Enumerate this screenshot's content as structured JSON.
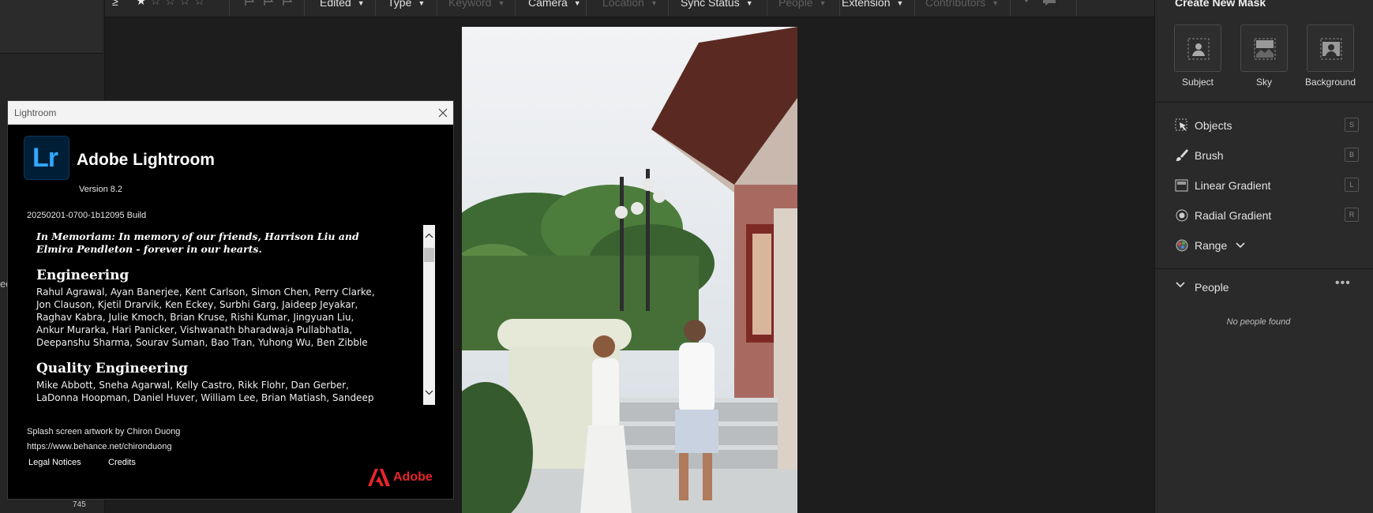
{
  "filter_bar": {
    "items": [
      {
        "label": "Edited",
        "enabled": true
      },
      {
        "label": "Type",
        "enabled": true
      },
      {
        "label": "Keyword",
        "enabled": false
      },
      {
        "label": "Camera",
        "enabled": true
      },
      {
        "label": "Location",
        "enabled": false
      },
      {
        "label": "Sync Status",
        "enabled": true
      },
      {
        "label": "People",
        "enabled": false
      },
      {
        "label": "Extension",
        "enabled": true
      },
      {
        "label": "Contributors",
        "enabled": false
      }
    ],
    "rating_prefix": "≥",
    "stars": 5
  },
  "left_strip": {
    "cut_text": "ed",
    "count": "745"
  },
  "right_panel": {
    "title": "Create New Mask",
    "mask_types": [
      {
        "label": "Subject",
        "icon": "subject-icon"
      },
      {
        "label": "Sky",
        "icon": "sky-icon"
      },
      {
        "label": "Background",
        "icon": "background-icon"
      }
    ],
    "tools": [
      {
        "label": "Objects",
        "key": "S",
        "icon": "objects-icon"
      },
      {
        "label": "Brush",
        "key": "B",
        "icon": "brush-icon"
      },
      {
        "label": "Linear Gradient",
        "key": "L",
        "icon": "linear-gradient-icon"
      },
      {
        "label": "Radial Gradient",
        "key": "R",
        "icon": "radial-gradient-icon"
      },
      {
        "label": "Range",
        "key": "",
        "icon": "range-icon"
      }
    ],
    "people": {
      "label": "People",
      "empty_text": "No people found"
    }
  },
  "about": {
    "window_title": "Lightroom",
    "logo_text": "Lr",
    "app_name": "Adobe Lightroom",
    "version": "Version 8.2",
    "build": "20250201-0700-1b12095 Build",
    "memoriam": "In Memoriam: In memory of our friends, Harrison Liu and Elmira Pendleton - forever in our hearts.",
    "sections": [
      {
        "heading": "Engineering",
        "names": "Rahul Agrawal, Ayan Banerjee, Kent Carlson, Simon Chen, Perry Clarke, Jon Clauson, Kjetil Drarvik, Ken Eckey, Surbhi Garg, Jaideep Jeyakar, Raghav Kabra, Julie Kmoch, Brian Kruse, Rishi Kumar, Jingyuan Liu, Ankur Murarka, Hari Panicker, Vishwanath bharadwaja Pullabhatla, Deepanshu Sharma, Sourav Suman, Bao Tran, Yuhong Wu, Ben Zibble"
      },
      {
        "heading": "Quality Engineering",
        "names": "Mike Abbott, Sneha Agarwal, Kelly Castro, Rikk Flohr, Dan Gerber, LaDonna Hoopman, Daniel Huver, William Lee, Brian Matiash, Sandeep Mondal, Les"
      }
    ],
    "artwork_by": "Splash screen artwork by Chiron Duong",
    "artwork_url": "https://www.behance.net/chironduong",
    "legal_notices": "Legal Notices",
    "credits": "Credits",
    "adobe_brand": "Adobe"
  },
  "colors": {
    "lr_blue": "#31a8ff",
    "adobe_red": "#e8252b"
  }
}
